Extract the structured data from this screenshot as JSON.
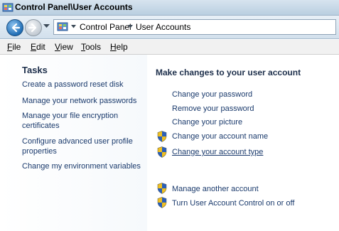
{
  "window": {
    "title": "Control Panel\\User Accounts"
  },
  "address": {
    "crumbs": [
      "Control Panel",
      "User Accounts"
    ]
  },
  "menu": [
    {
      "first": "F",
      "rest": "ile"
    },
    {
      "first": "E",
      "rest": "dit"
    },
    {
      "first": "V",
      "rest": "iew"
    },
    {
      "first": "T",
      "rest": "ools"
    },
    {
      "first": "H",
      "rest": "elp"
    }
  ],
  "tasks": {
    "heading": "Tasks",
    "items": [
      "Create a password reset disk",
      "Manage your network passwords",
      "Manage your file encryption certificates",
      "Configure advanced user profile properties",
      "Change my environment variables"
    ]
  },
  "main": {
    "heading": "Make changes to your user account",
    "links": [
      {
        "label": "Change your password",
        "icon": ""
      },
      {
        "label": "Remove your password",
        "icon": ""
      },
      {
        "label": "Change your picture",
        "icon": ""
      },
      {
        "label": "Change your account name",
        "icon": "uac-shield-icon"
      },
      {
        "label": "Change your account type",
        "icon": "uac-shield-icon"
      }
    ],
    "other_links": [
      {
        "label": "Manage another account",
        "icon": "uac-shield-icon"
      },
      {
        "label": "Turn User Account Control on or off",
        "icon": "uac-shield-icon"
      }
    ]
  },
  "colors": {
    "link": "#1a3a6c",
    "heading": "#1c2e4a",
    "shield_blue": "#2b5fb8",
    "shield_yellow": "#f0c020"
  }
}
